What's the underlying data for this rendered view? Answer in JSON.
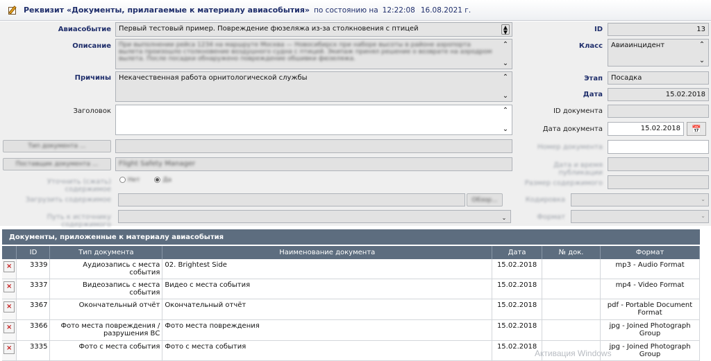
{
  "header": {
    "title": "Реквизит «Документы, прилагаемые к материалу авиасобытия»",
    "state_label": "по состоянию на",
    "time": "12:22:08",
    "date": "16.08.2021 г."
  },
  "form": {
    "event_label": "Авиасобытие",
    "event_value": "Первый тестовый пример. Повреждение фюзеляжа из-за столкновения с птицей",
    "description_label": "Описание",
    "description_value": "При выполнении рейса 1234 на маршруте Москва — Новосибирск при наборе высоты в районе аэропорта вылета произошло столкновение воздушного судна с птицей. Экипаж принял решение о возврате на аэродром вылета. После посадки обнаружено повреждение обшивки фюзеляжа.",
    "causes_label": "Причины",
    "causes_value": "Некачественная работа орнитологической службы",
    "heading_label": "Заголовок",
    "heading_value": "",
    "id_label": "ID",
    "id_value": "13",
    "class_label": "Класс",
    "class_value": "Авиаинцидент",
    "stage_label": "Этап",
    "stage_value": "Посадка",
    "date_label": "Дата",
    "date_value": "15.02.2018",
    "doc_id_label": "ID документа",
    "doc_id_value": "",
    "doc_date_label": "Дата документа",
    "doc_date_value": "15.02.2018",
    "doc_type_btn": "Тип документа ...",
    "doc_source_btn": "Поставщик документа ...",
    "doc_source_value": "Flight Safety Manager",
    "specify_label": "Уточнить (сжать) содержимое",
    "radio_no": "Нет",
    "radio_yes": "Да",
    "upload_label": "Загрузить содержимое",
    "browse_btn": "Обзор...",
    "path_label": "Путь к источнику содержимого",
    "doc_number_label": "Номер документа",
    "pub_datetime_label": "Дата и время публикации",
    "size_label": "Размер содержимого",
    "encoding_label": "Кодировка",
    "format_label": "Формат"
  },
  "grid": {
    "title": "Документы, приложенные к материалу авиасобытия",
    "columns": [
      "ID",
      "Тип документа",
      "Наименование документа",
      "Дата",
      "№ док.",
      "Формат"
    ],
    "rows": [
      {
        "id": "3339",
        "type": "Аудиозапись с места события",
        "name": "02. Brightest Side",
        "date": "15.02.2018",
        "docno": "",
        "format": "mp3 - Audio Format"
      },
      {
        "id": "3337",
        "type": "Видеозапись с места события",
        "name": "Видео с места события",
        "date": "15.02.2018",
        "docno": "",
        "format": "mp4 - Video Format"
      },
      {
        "id": "3367",
        "type": "Окончательный отчёт",
        "name": "Окончательный отчёт",
        "date": "15.02.2018",
        "docno": "",
        "format": "pdf - Portable Document Format"
      },
      {
        "id": "3366",
        "type": "Фото места повреждения / разрушения ВС",
        "name": "Фото места повреждения",
        "date": "15.02.2018",
        "docno": "",
        "format": "jpg - Joined Photograph Group"
      },
      {
        "id": "3335",
        "type": "Фото с места события",
        "name": "Фото с места события",
        "date": "15.02.2018",
        "docno": "",
        "format": "jpg - Joined Photograph Group"
      }
    ]
  },
  "watermark": "Активация Windows",
  "icons": {
    "header": "edit-note-icon",
    "delete": "delete-x-icon",
    "calendar": "calendar-icon"
  }
}
